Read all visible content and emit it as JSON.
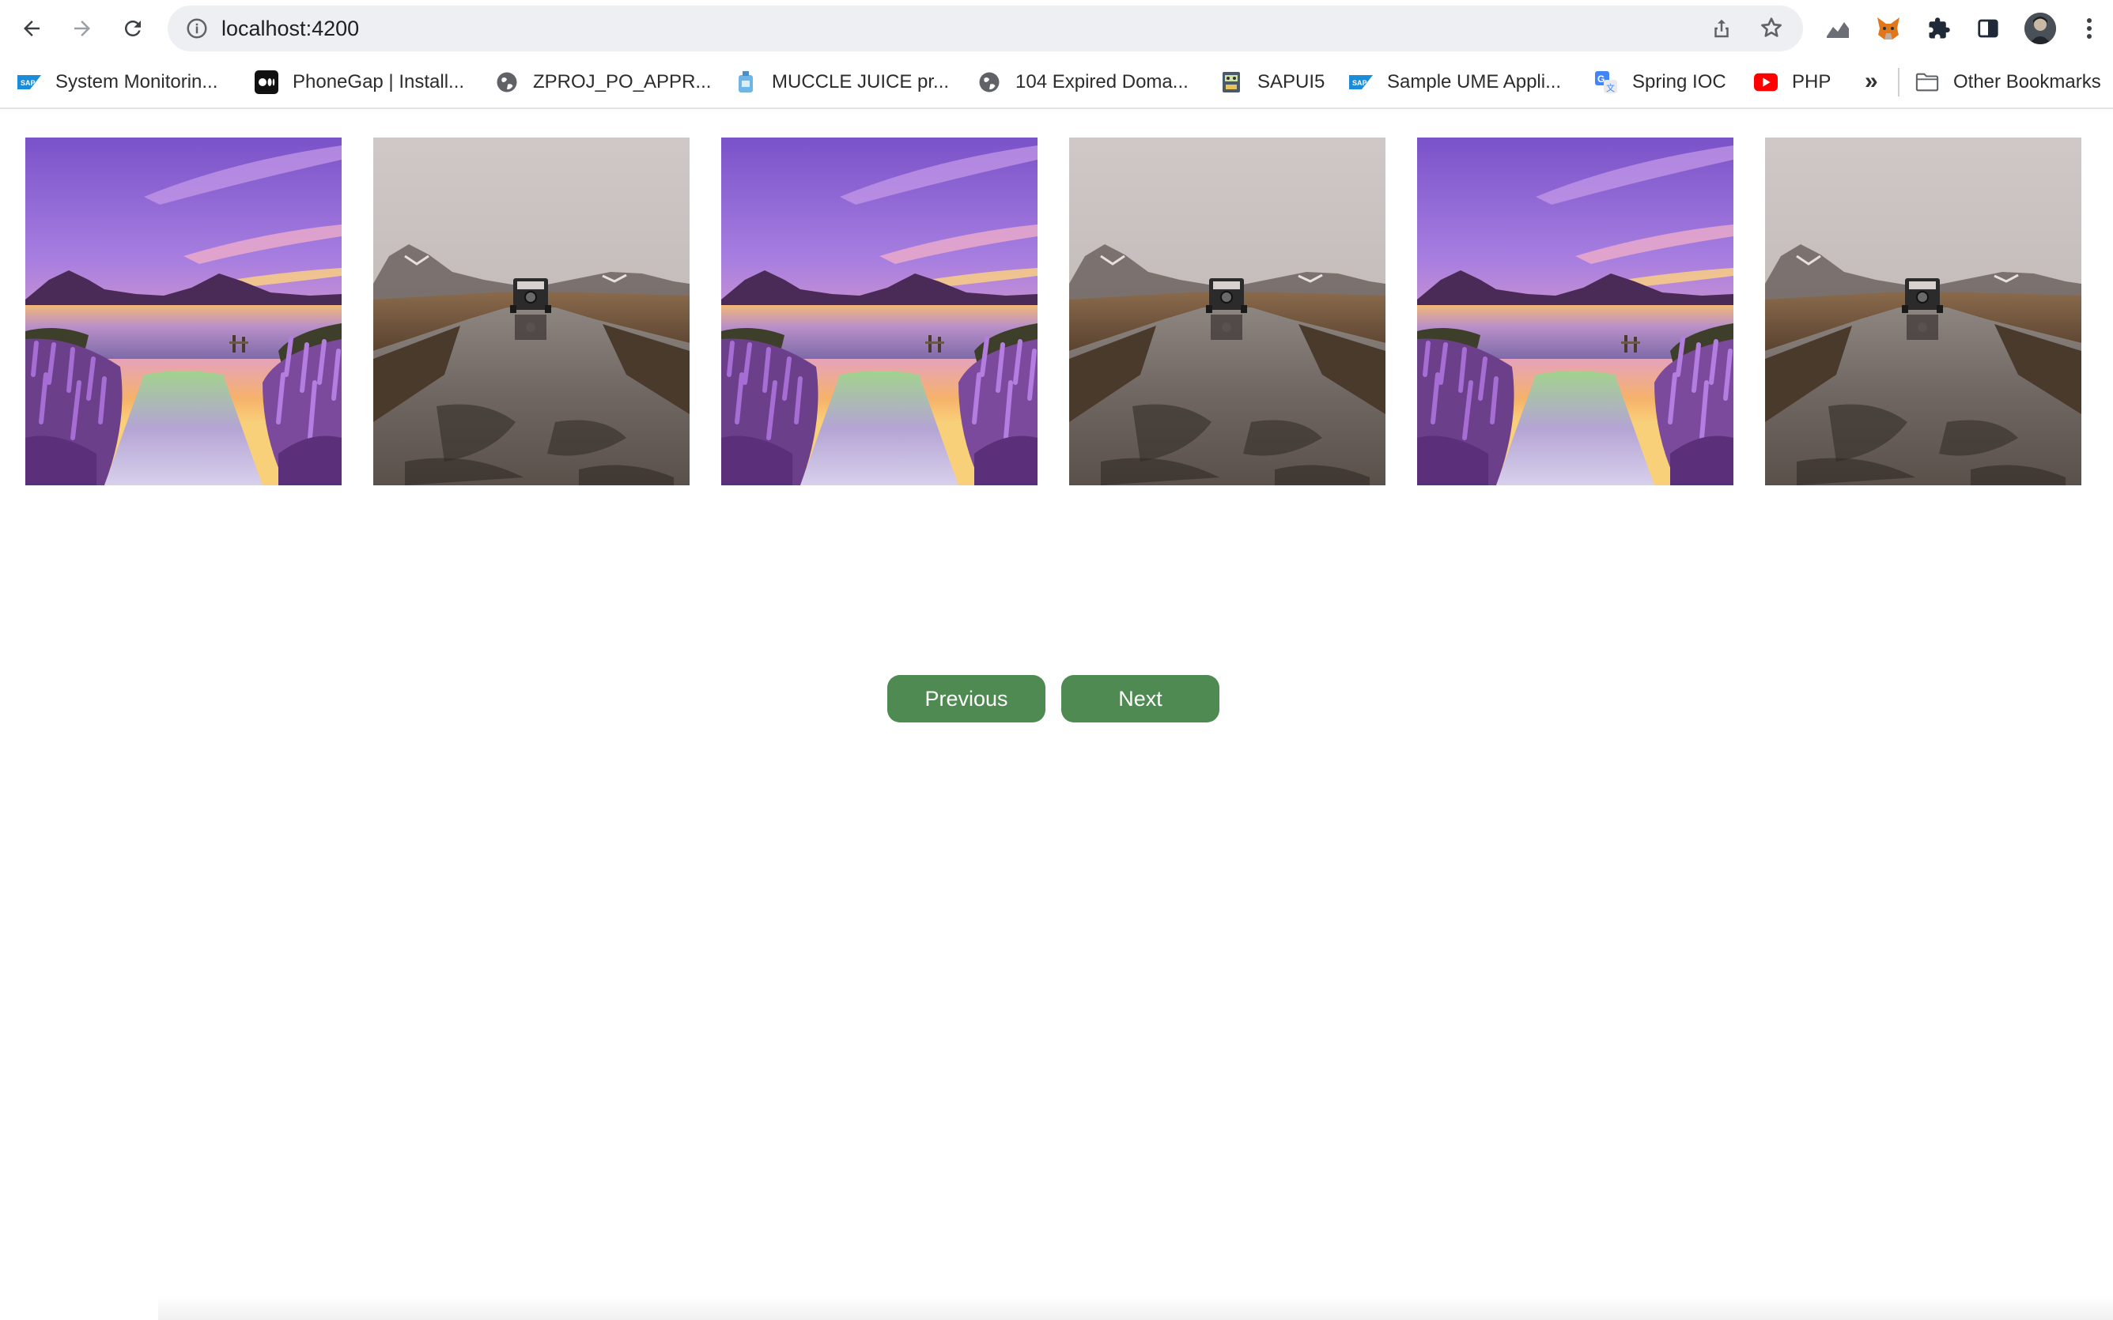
{
  "browser": {
    "url": "localhost:4200",
    "bookmarks": [
      {
        "label": "System Monitorin...",
        "icon": "sap-icon"
      },
      {
        "label": "PhoneGap | Install...",
        "icon": "medium-icon"
      },
      {
        "label": "ZPROJ_PO_APPR...",
        "icon": "globe-icon"
      },
      {
        "label": "MUCCLE JUICE pr...",
        "icon": "bottle-icon"
      },
      {
        "label": "104 Expired Doma...",
        "icon": "globe-icon"
      },
      {
        "label": "SAPUI5",
        "icon": "robot-icon"
      },
      {
        "label": "Sample UME Appli...",
        "icon": "sap-icon"
      },
      {
        "label": "Spring IOC",
        "icon": "translate-icon"
      },
      {
        "label": "PHP",
        "icon": "youtube-icon"
      }
    ],
    "overflow_label": "»",
    "other_bookmarks": "Other Bookmarks"
  },
  "gallery": {
    "images": [
      {
        "scene": "lavender-sunset-lake"
      },
      {
        "scene": "foggy-jeep-road"
      },
      {
        "scene": "lavender-sunset-lake"
      },
      {
        "scene": "foggy-jeep-road"
      },
      {
        "scene": "lavender-sunset-lake"
      },
      {
        "scene": "foggy-jeep-road"
      }
    ]
  },
  "pager": {
    "previous_label": "Previous",
    "next_label": "Next",
    "button_color": "#4e8a52"
  }
}
